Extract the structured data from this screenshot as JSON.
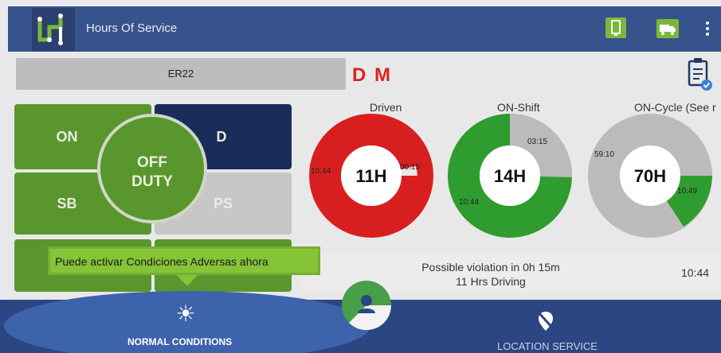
{
  "app": {
    "title": "Hours Of Service"
  },
  "vehicle": {
    "label": "ER22"
  },
  "mode": {
    "text": "D M",
    "color": "#dd2222"
  },
  "status_buttons": {
    "on": "ON",
    "d": "D",
    "sb": "SB",
    "ps": "PS",
    "current": "OFF\nDUTY"
  },
  "gauges": [
    {
      "title": "Driven",
      "center": "11H",
      "left_value": "10:44",
      "right_value": "00:15",
      "colors": {
        "used": "#d81f1f",
        "remaining": "#e8e8e8"
      }
    },
    {
      "title": "ON-Shift",
      "center": "14H",
      "left_value": "10:44",
      "right_value": "03:15",
      "colors": {
        "used": "#2e9c2e",
        "remaining": "#bbbbbb"
      }
    },
    {
      "title": "ON-Cycle (See r",
      "center": "70H",
      "left_value": "59:10",
      "right_value": "10:49",
      "colors": {
        "used": "#bbbbbb",
        "remaining": "#2e9c2e"
      }
    }
  ],
  "violation": {
    "line1": "Possible violation in 0h 15m",
    "line2": "11 Hrs Driving",
    "time": "10:44"
  },
  "tooltip": {
    "text": "Puede activar Condiciones Adversas ahora"
  },
  "bottom_nav": {
    "normal": "NORMAL CONDITIONS",
    "location": "LOCATION SERVICE"
  },
  "icons": {
    "logo": "app-logo-icon",
    "phone": "phone-icon",
    "truck": "truck-icon",
    "menu": "more-vert-icon",
    "clipboard": "clipboard-check-icon",
    "sun": "sun-icon",
    "location_off": "location-off-icon",
    "person": "person-icon"
  },
  "colors": {
    "appbar": "#36538b",
    "green": "#5a962e",
    "navy": "#1a2d5a",
    "bottom": "#2c4682"
  }
}
